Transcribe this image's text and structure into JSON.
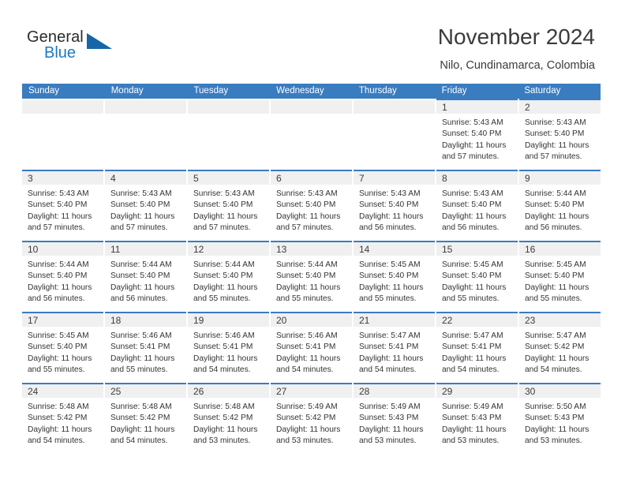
{
  "brand": {
    "name_part1": "General",
    "name_part2": "Blue",
    "accent_color": "#1b79c4",
    "triangle_color": "#1565a8"
  },
  "header": {
    "month_title": "November 2024",
    "location": "Nilo, Cundinamarca, Colombia"
  },
  "calendar": {
    "header_bg": "#3a7cc0",
    "daynum_band_bg": "#f0f0f0",
    "weekdays": [
      "Sunday",
      "Monday",
      "Tuesday",
      "Wednesday",
      "Thursday",
      "Friday",
      "Saturday"
    ],
    "weeks": [
      [
        {
          "empty": true
        },
        {
          "empty": true
        },
        {
          "empty": true
        },
        {
          "empty": true
        },
        {
          "empty": true
        },
        {
          "day": "1",
          "sunrise": "Sunrise: 5:43 AM",
          "sunset": "Sunset: 5:40 PM",
          "daylight_line1": "Daylight: 11 hours",
          "daylight_line2": "and 57 minutes."
        },
        {
          "day": "2",
          "sunrise": "Sunrise: 5:43 AM",
          "sunset": "Sunset: 5:40 PM",
          "daylight_line1": "Daylight: 11 hours",
          "daylight_line2": "and 57 minutes."
        }
      ],
      [
        {
          "day": "3",
          "sunrise": "Sunrise: 5:43 AM",
          "sunset": "Sunset: 5:40 PM",
          "daylight_line1": "Daylight: 11 hours",
          "daylight_line2": "and 57 minutes."
        },
        {
          "day": "4",
          "sunrise": "Sunrise: 5:43 AM",
          "sunset": "Sunset: 5:40 PM",
          "daylight_line1": "Daylight: 11 hours",
          "daylight_line2": "and 57 minutes."
        },
        {
          "day": "5",
          "sunrise": "Sunrise: 5:43 AM",
          "sunset": "Sunset: 5:40 PM",
          "daylight_line1": "Daylight: 11 hours",
          "daylight_line2": "and 57 minutes."
        },
        {
          "day": "6",
          "sunrise": "Sunrise: 5:43 AM",
          "sunset": "Sunset: 5:40 PM",
          "daylight_line1": "Daylight: 11 hours",
          "daylight_line2": "and 57 minutes."
        },
        {
          "day": "7",
          "sunrise": "Sunrise: 5:43 AM",
          "sunset": "Sunset: 5:40 PM",
          "daylight_line1": "Daylight: 11 hours",
          "daylight_line2": "and 56 minutes."
        },
        {
          "day": "8",
          "sunrise": "Sunrise: 5:43 AM",
          "sunset": "Sunset: 5:40 PM",
          "daylight_line1": "Daylight: 11 hours",
          "daylight_line2": "and 56 minutes."
        },
        {
          "day": "9",
          "sunrise": "Sunrise: 5:44 AM",
          "sunset": "Sunset: 5:40 PM",
          "daylight_line1": "Daylight: 11 hours",
          "daylight_line2": "and 56 minutes."
        }
      ],
      [
        {
          "day": "10",
          "sunrise": "Sunrise: 5:44 AM",
          "sunset": "Sunset: 5:40 PM",
          "daylight_line1": "Daylight: 11 hours",
          "daylight_line2": "and 56 minutes."
        },
        {
          "day": "11",
          "sunrise": "Sunrise: 5:44 AM",
          "sunset": "Sunset: 5:40 PM",
          "daylight_line1": "Daylight: 11 hours",
          "daylight_line2": "and 56 minutes."
        },
        {
          "day": "12",
          "sunrise": "Sunrise: 5:44 AM",
          "sunset": "Sunset: 5:40 PM",
          "daylight_line1": "Daylight: 11 hours",
          "daylight_line2": "and 55 minutes."
        },
        {
          "day": "13",
          "sunrise": "Sunrise: 5:44 AM",
          "sunset": "Sunset: 5:40 PM",
          "daylight_line1": "Daylight: 11 hours",
          "daylight_line2": "and 55 minutes."
        },
        {
          "day": "14",
          "sunrise": "Sunrise: 5:45 AM",
          "sunset": "Sunset: 5:40 PM",
          "daylight_line1": "Daylight: 11 hours",
          "daylight_line2": "and 55 minutes."
        },
        {
          "day": "15",
          "sunrise": "Sunrise: 5:45 AM",
          "sunset": "Sunset: 5:40 PM",
          "daylight_line1": "Daylight: 11 hours",
          "daylight_line2": "and 55 minutes."
        },
        {
          "day": "16",
          "sunrise": "Sunrise: 5:45 AM",
          "sunset": "Sunset: 5:40 PM",
          "daylight_line1": "Daylight: 11 hours",
          "daylight_line2": "and 55 minutes."
        }
      ],
      [
        {
          "day": "17",
          "sunrise": "Sunrise: 5:45 AM",
          "sunset": "Sunset: 5:40 PM",
          "daylight_line1": "Daylight: 11 hours",
          "daylight_line2": "and 55 minutes."
        },
        {
          "day": "18",
          "sunrise": "Sunrise: 5:46 AM",
          "sunset": "Sunset: 5:41 PM",
          "daylight_line1": "Daylight: 11 hours",
          "daylight_line2": "and 55 minutes."
        },
        {
          "day": "19",
          "sunrise": "Sunrise: 5:46 AM",
          "sunset": "Sunset: 5:41 PM",
          "daylight_line1": "Daylight: 11 hours",
          "daylight_line2": "and 54 minutes."
        },
        {
          "day": "20",
          "sunrise": "Sunrise: 5:46 AM",
          "sunset": "Sunset: 5:41 PM",
          "daylight_line1": "Daylight: 11 hours",
          "daylight_line2": "and 54 minutes."
        },
        {
          "day": "21",
          "sunrise": "Sunrise: 5:47 AM",
          "sunset": "Sunset: 5:41 PM",
          "daylight_line1": "Daylight: 11 hours",
          "daylight_line2": "and 54 minutes."
        },
        {
          "day": "22",
          "sunrise": "Sunrise: 5:47 AM",
          "sunset": "Sunset: 5:41 PM",
          "daylight_line1": "Daylight: 11 hours",
          "daylight_line2": "and 54 minutes."
        },
        {
          "day": "23",
          "sunrise": "Sunrise: 5:47 AM",
          "sunset": "Sunset: 5:42 PM",
          "daylight_line1": "Daylight: 11 hours",
          "daylight_line2": "and 54 minutes."
        }
      ],
      [
        {
          "day": "24",
          "sunrise": "Sunrise: 5:48 AM",
          "sunset": "Sunset: 5:42 PM",
          "daylight_line1": "Daylight: 11 hours",
          "daylight_line2": "and 54 minutes."
        },
        {
          "day": "25",
          "sunrise": "Sunrise: 5:48 AM",
          "sunset": "Sunset: 5:42 PM",
          "daylight_line1": "Daylight: 11 hours",
          "daylight_line2": "and 54 minutes."
        },
        {
          "day": "26",
          "sunrise": "Sunrise: 5:48 AM",
          "sunset": "Sunset: 5:42 PM",
          "daylight_line1": "Daylight: 11 hours",
          "daylight_line2": "and 53 minutes."
        },
        {
          "day": "27",
          "sunrise": "Sunrise: 5:49 AM",
          "sunset": "Sunset: 5:42 PM",
          "daylight_line1": "Daylight: 11 hours",
          "daylight_line2": "and 53 minutes."
        },
        {
          "day": "28",
          "sunrise": "Sunrise: 5:49 AM",
          "sunset": "Sunset: 5:43 PM",
          "daylight_line1": "Daylight: 11 hours",
          "daylight_line2": "and 53 minutes."
        },
        {
          "day": "29",
          "sunrise": "Sunrise: 5:49 AM",
          "sunset": "Sunset: 5:43 PM",
          "daylight_line1": "Daylight: 11 hours",
          "daylight_line2": "and 53 minutes."
        },
        {
          "day": "30",
          "sunrise": "Sunrise: 5:50 AM",
          "sunset": "Sunset: 5:43 PM",
          "daylight_line1": "Daylight: 11 hours",
          "daylight_line2": "and 53 minutes."
        }
      ]
    ]
  }
}
